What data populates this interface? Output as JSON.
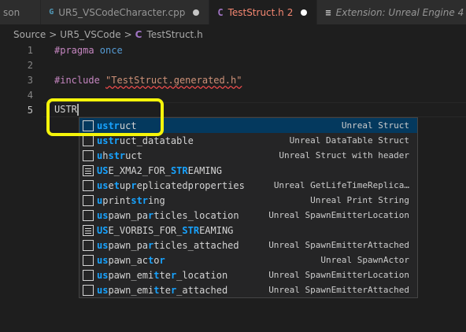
{
  "tabs": [
    {
      "label": "son",
      "icon": "",
      "state": "plain"
    },
    {
      "label": "UR5_VSCodeCharacter.cpp",
      "icon": "G",
      "state": "modified"
    },
    {
      "label": "TestStruct.h",
      "icon": "C",
      "badge": "2",
      "state": "active-modified"
    },
    {
      "label": "Extension: Unreal Engine 4 S",
      "icon": "≡",
      "state": "preview"
    }
  ],
  "breadcrumb": {
    "items": [
      "Source",
      "UR5_VSCode",
      "TestStruct.h"
    ],
    "separator": ">",
    "file_icon": "C"
  },
  "editor": {
    "line_numbers": [
      "1",
      "2",
      "3",
      "4",
      "5"
    ],
    "line1": {
      "directive": "#pragma",
      "rest": " once"
    },
    "line3": {
      "directive": "#include",
      "string": "\"TestStruct.generated.h\""
    },
    "line5": {
      "typed": "USTR"
    }
  },
  "suggestions": [
    {
      "pre": "",
      "match": "ustr",
      "post": "uct",
      "detail": "Unreal Struct",
      "kind": "snippet"
    },
    {
      "pre": "",
      "match": "ustr",
      "post": "uct_datatable",
      "detail": "Unreal DataTable Struct",
      "kind": "snippet"
    },
    {
      "pre": "",
      "match": "u",
      "post": "h",
      "match2": "str",
      "post2": "uct",
      "detail": "Unreal Struct with header",
      "kind": "snippet"
    },
    {
      "pre": "",
      "match": "US",
      "post": "E_XMA2_FOR_",
      "match2": "STR",
      "post2": "EAMING",
      "detail": "",
      "kind": "text"
    },
    {
      "pre": "",
      "match": "us",
      "post": "e",
      "match2": "t",
      "post2": "up",
      "match3": "r",
      "post3": "eplicatedproperties",
      "detail": "Unreal GetLifeTimeReplica…",
      "kind": "snippet"
    },
    {
      "pre": "",
      "match": "u",
      "post": "print",
      "match2": "str",
      "post2": "ing",
      "detail": "Unreal Print String",
      "kind": "snippet"
    },
    {
      "pre": "",
      "match": "us",
      "post": "pawn_pa",
      "match2": "r",
      "post2": "ticles_location",
      "match3": "",
      "post3": "",
      "detail": "Unreal SpawnEmitterLocation",
      "kind": "snippet",
      "tr": "t"
    },
    {
      "pre": "",
      "match": "US",
      "post": "E_VORBIS_FOR_",
      "match2": "STR",
      "post2": "EAMING",
      "detail": "",
      "kind": "text"
    },
    {
      "pre": "",
      "match": "us",
      "post": "pawn_pa",
      "match2": "r",
      "post2": "ticles_attached",
      "detail": "Unreal SpawnEmitterAttached",
      "kind": "snippet"
    },
    {
      "pre": "",
      "match": "us",
      "post": "pawn_ac",
      "match2": "t",
      "post2": "o",
      "match3": "r",
      "post3": "",
      "detail": "Unreal SpawnActor",
      "kind": "snippet"
    },
    {
      "pre": "",
      "match": "us",
      "post": "pawn_emi",
      "match2": "t",
      "post2": "te",
      "match3": "r",
      "post3": "_location",
      "detail": "Unreal SpawnEmitterLocation",
      "kind": "snippet"
    },
    {
      "pre": "",
      "match": "us",
      "post": "pawn_emi",
      "match2": "t",
      "post2": "te",
      "match3": "r",
      "post3": "_attached",
      "detail": "Unreal SpawnEmitterAttached",
      "kind": "snippet"
    }
  ],
  "colors": {
    "highlight": "#f5f50a",
    "match": "#18a3ff",
    "selected_row": "#04395e"
  }
}
